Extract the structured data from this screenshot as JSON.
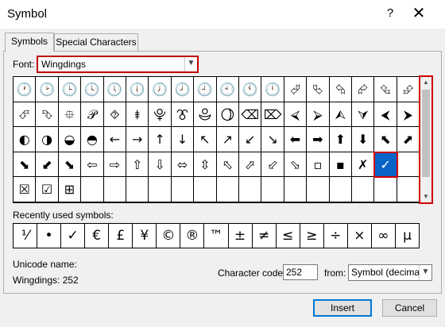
{
  "window": {
    "title": "Symbol",
    "help": "?",
    "close": "✕"
  },
  "tabs": [
    {
      "label": "Symbols",
      "active": true
    },
    {
      "label": "Special Characters",
      "active": false
    }
  ],
  "font": {
    "label": "Font:",
    "value": "Wingdings"
  },
  "symbol_grid": {
    "rows": [
      [
        "🕐",
        "🕑",
        "🕒",
        "🕓",
        "🕔",
        "🕕",
        "🕖",
        "🕗",
        "🕘",
        "🕙",
        "🕚",
        "🕛",
        "⮰",
        "⮱",
        "⮲",
        "⮳",
        "⮴",
        "⮵"
      ],
      [
        "⮶",
        "⮷",
        "⯐",
        "𝒫",
        "⯑",
        "⯒",
        "⯓",
        "⯔",
        "⯕",
        "⯖",
        "⌫",
        "⌦",
        "⮘",
        "⮚",
        "⮙",
        "⮛",
        "⮜",
        "⮞"
      ],
      [
        "◐",
        "◑",
        "◒",
        "◓",
        "←",
        "→",
        "↑",
        "↓",
        "↖",
        "↗",
        "↙",
        "↘",
        "⬅",
        "➡",
        "⬆",
        "⬇",
        "⬉",
        "⬈"
      ],
      [
        "⬊",
        "⬋",
        "⬊",
        "⇦",
        "⇨",
        "⇧",
        "⇩",
        "⬄",
        "⇳",
        "⬁",
        "⬀",
        "⬃",
        "⬂",
        "▫",
        "▪",
        "✗",
        "✓",
        ""
      ],
      [
        "☒",
        "☑",
        "⊞",
        "",
        "",
        "",
        "",
        "",
        "",
        "",
        "",
        "",
        "",
        "",
        "",
        "",
        "",
        ""
      ]
    ],
    "display_rows": [
      [
        "🕐",
        "🕑",
        "🕒",
        "🕓",
        "🕔",
        "🕕",
        "🕖",
        "🕗",
        "🕘",
        "🕙",
        "🕚",
        "🕛",
        "⮰",
        "⮱",
        "⮲",
        "⮳",
        "⮴",
        "⮵"
      ],
      [
        "⮶",
        "⮷",
        "⯐",
        "𝒫",
        "⯑",
        "⯒",
        "⯓",
        "⯔",
        "⯕",
        "⯖",
        "⌫",
        "⌦",
        "⮘",
        "⮚",
        "⮙",
        "⮛",
        "⮜",
        "⮞"
      ],
      [
        "◐",
        "◑",
        "◒",
        "◓",
        "←",
        "→",
        "↑",
        "↓",
        "↖",
        "↗",
        "↙",
        "↘",
        "⬅",
        "➡",
        "⬆",
        "⬇",
        "⬉",
        "⬈"
      ],
      [
        "⬊",
        "⬋",
        "⬊",
        "⇦",
        "⇨",
        "⇧",
        "⇩",
        "⬄",
        "⇳",
        "⬁",
        "⬀",
        "⬃",
        "⬂",
        "▫",
        "▪",
        "✗",
        "✓",
        ""
      ],
      [
        "☒",
        "☑",
        "⊞",
        "",
        "",
        "",
        "",
        "",
        "",
        "",
        "",
        "",
        "",
        "",
        "",
        "",
        "",
        ""
      ]
    ],
    "selected": {
      "row": 3,
      "col": 16
    }
  },
  "recent": {
    "label": "Recently used symbols:",
    "symbols": [
      "⅟",
      "•",
      "✓",
      "€",
      "£",
      "¥",
      "©",
      "®",
      "™",
      "±",
      "≠",
      "≤",
      "≥",
      "÷",
      "×",
      "∞",
      "µ"
    ]
  },
  "unicode": {
    "label": "Unicode name:",
    "value": "Wingdings: 252"
  },
  "char_code": {
    "label": "Character code:",
    "value": "252"
  },
  "from": {
    "label": "from:",
    "value": "Symbol (decimal)"
  },
  "buttons": {
    "insert": "Insert",
    "cancel": "Cancel"
  },
  "colors": {
    "highlight": "#d00000",
    "selected": "#0a64c8",
    "focus": "#0078d7"
  }
}
